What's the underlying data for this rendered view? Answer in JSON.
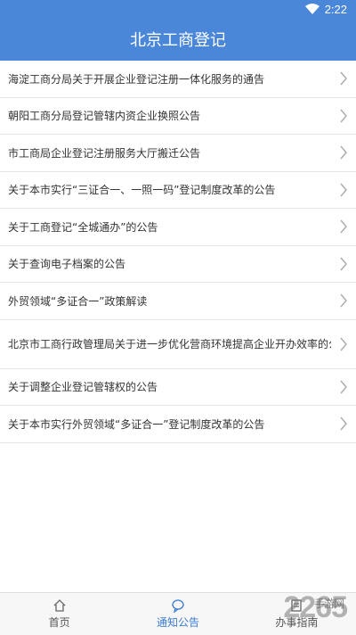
{
  "status_bar": {
    "time": "2:22"
  },
  "app_bar": {
    "title": "北京工商登记"
  },
  "list": [
    {
      "label": "海淀工商分局关于开展企业登记注册一体化服务的通告"
    },
    {
      "label": "朝阳工商分局登记管辖内资企业换照公告"
    },
    {
      "label": "市工商局企业登记注册服务大厅搬迁公告"
    },
    {
      "label": "关于本市实行“三证合一、一照一码”登记制度改革的公告"
    },
    {
      "label": "关于工商登记“全城通办”的公告"
    },
    {
      "label": "关于查询电子档案的公告"
    },
    {
      "label": "外贸领域“多证合一”政策解读"
    },
    {
      "label": "北京市工商行政管理局关于进一步优化营商环境提高企业开办效率的公告"
    },
    {
      "label": "关于调整企业登记管辖权的公告"
    },
    {
      "label": "关于本市实行外贸领域“多证合一”登记制度改革的公告"
    }
  ],
  "bottom_nav": [
    {
      "label": "首页",
      "icon": "home-icon"
    },
    {
      "label": "通知公告",
      "icon": "chat-icon",
      "active": true
    },
    {
      "label": "办事指南",
      "icon": "guide-icon"
    }
  ],
  "watermark": {
    "text": "2265",
    "sub": "手游网"
  },
  "colors": {
    "header": "#4a87d9",
    "active_tab": "#3b7bd4"
  }
}
